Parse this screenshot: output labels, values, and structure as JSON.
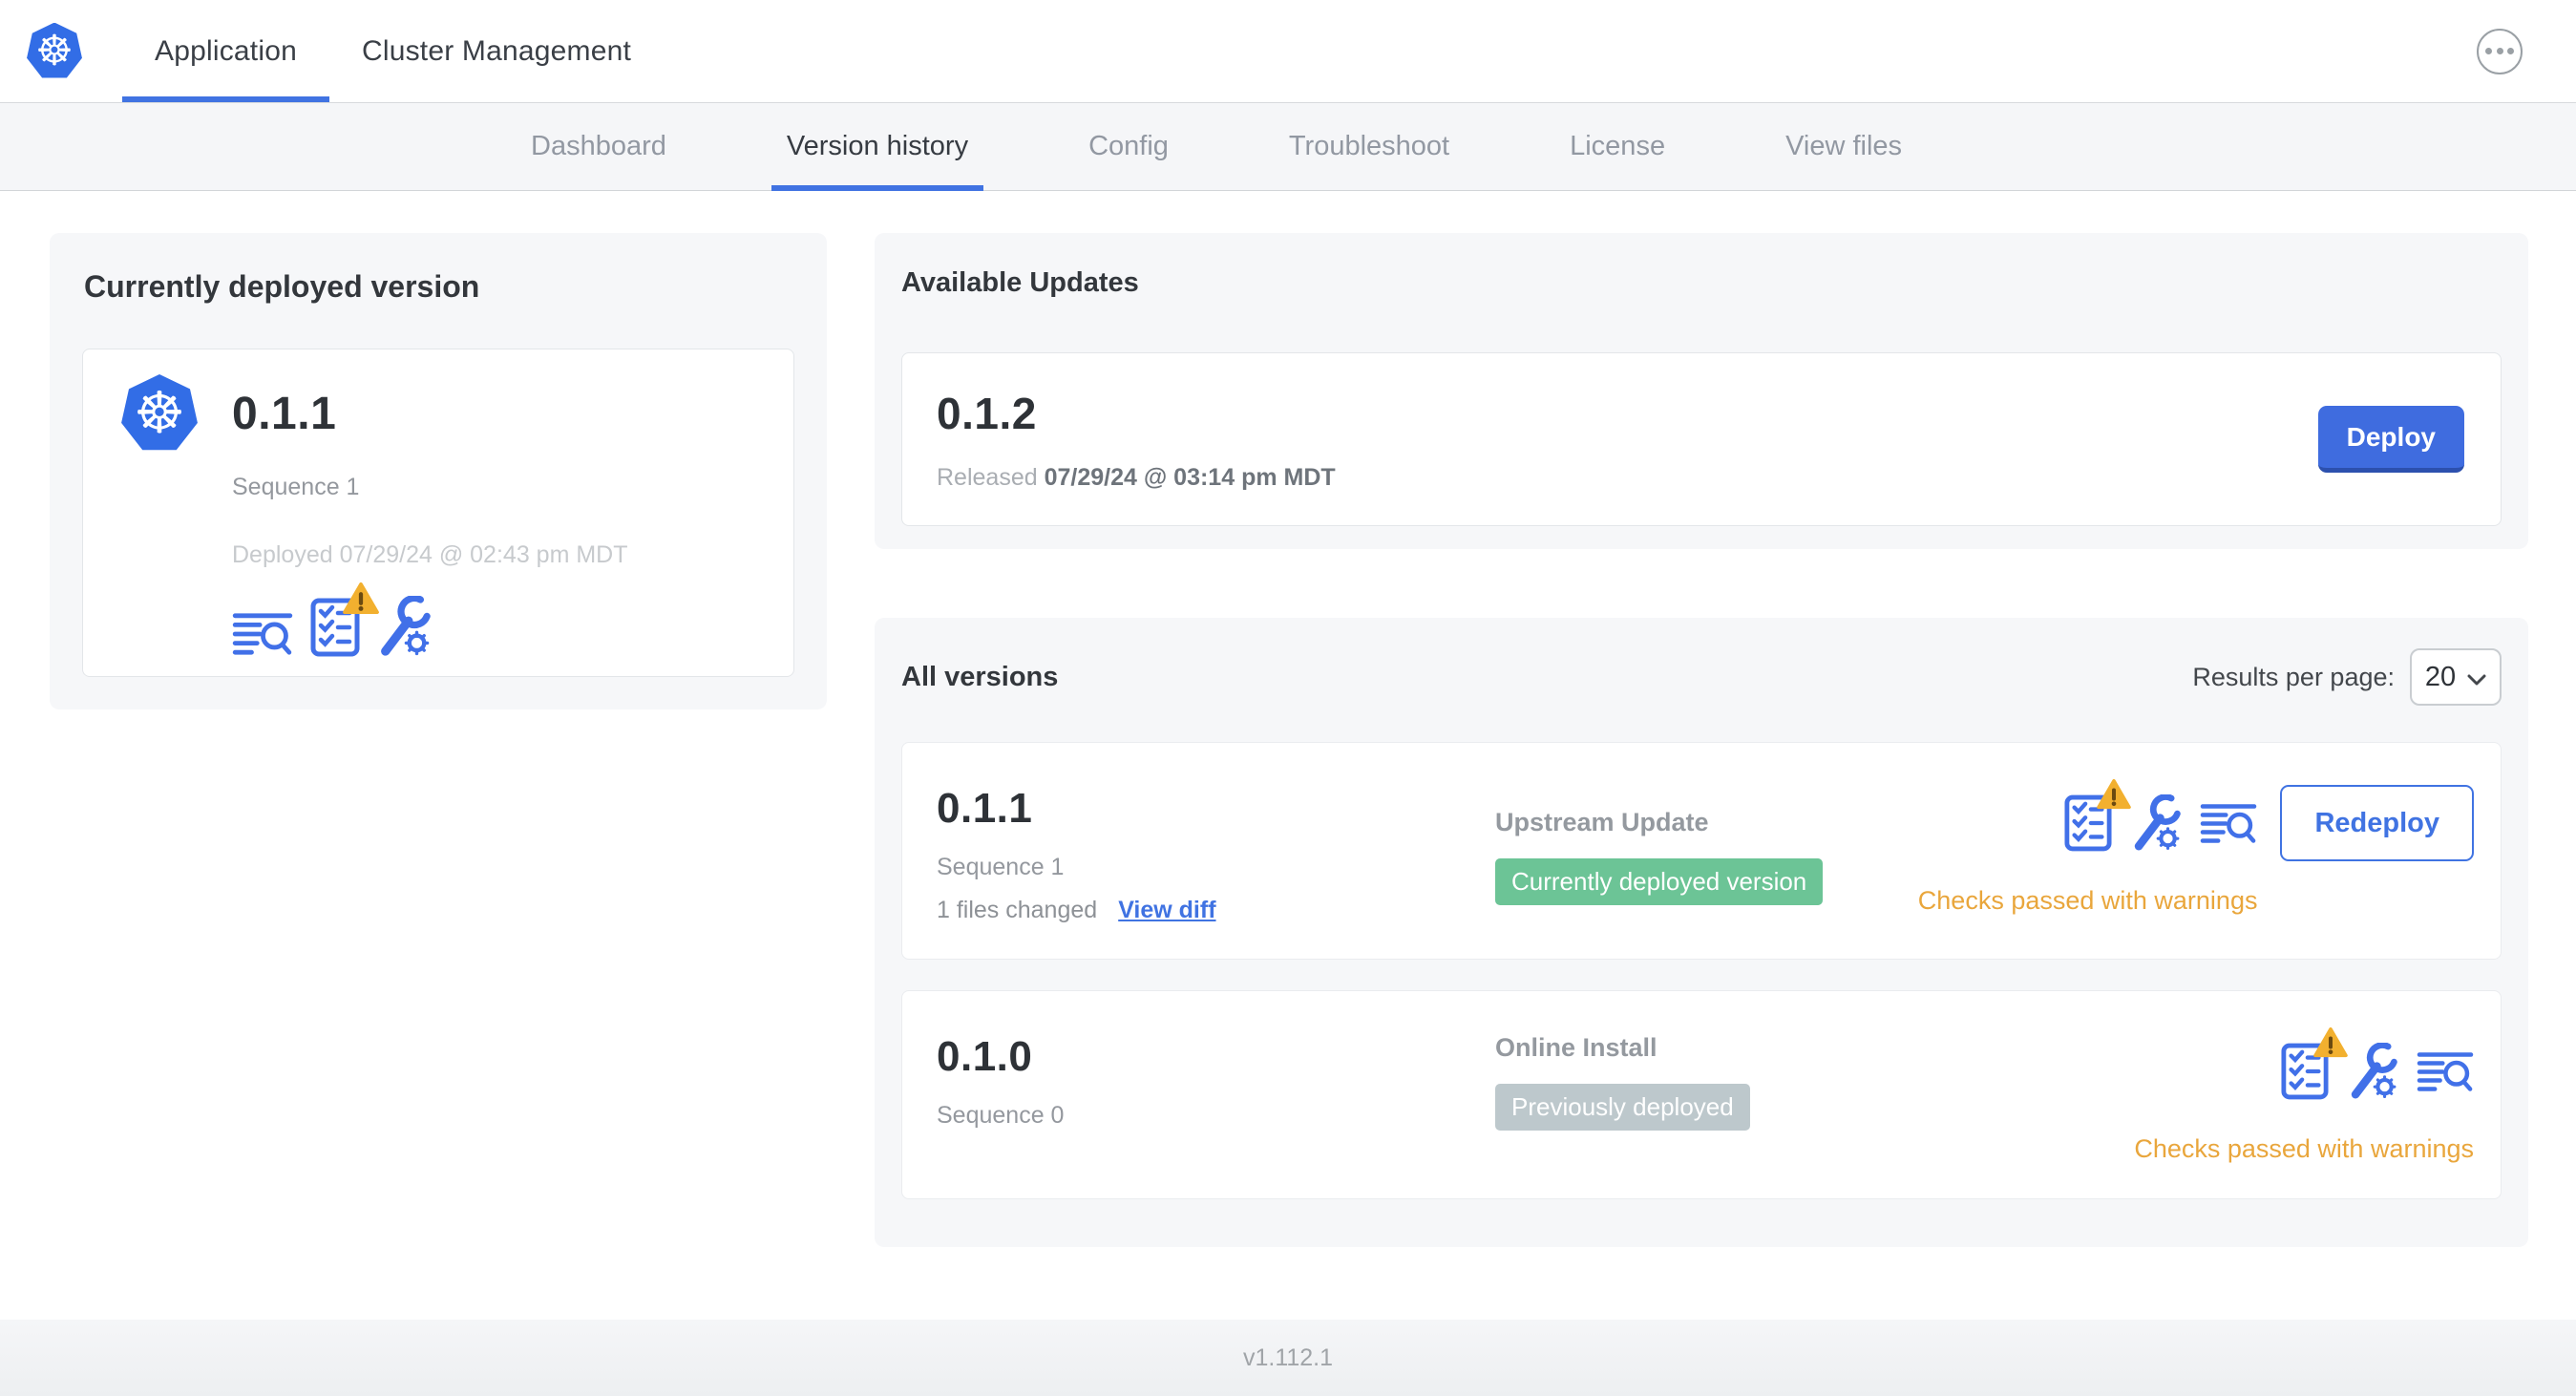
{
  "header": {
    "tabs": [
      {
        "label": "Application",
        "active": true
      },
      {
        "label": "Cluster Management",
        "active": false
      }
    ]
  },
  "subnav": {
    "tabs": [
      {
        "label": "Dashboard",
        "active": false
      },
      {
        "label": "Version history",
        "active": true
      },
      {
        "label": "Config",
        "active": false
      },
      {
        "label": "Troubleshoot",
        "active": false
      },
      {
        "label": "License",
        "active": false
      },
      {
        "label": "View files",
        "active": false
      }
    ]
  },
  "current_version": {
    "title": "Currently deployed version",
    "version": "0.1.1",
    "sequence": "Sequence 1",
    "deployed": "Deployed 07/29/24 @ 02:43 pm MDT"
  },
  "available_updates": {
    "title": "Available Updates",
    "version": "0.1.2",
    "released_label": "Released",
    "released_date": "07/29/24 @ 03:14 pm MDT",
    "deploy_label": "Deploy"
  },
  "all_versions": {
    "title": "All versions",
    "results_per_page_label": "Results per page:",
    "results_per_page_value": "20",
    "rows": [
      {
        "version": "0.1.1",
        "sequence": "Sequence 1",
        "files_changed": "1 files changed",
        "view_diff_label": "View diff",
        "source": "Upstream Update",
        "badge": "Currently deployed version",
        "badge_color": "green",
        "status": "Checks passed with warnings",
        "action_label": "Redeploy"
      },
      {
        "version": "0.1.0",
        "sequence": "Sequence 0",
        "source": "Online Install",
        "badge": "Previously deployed",
        "badge_color": "gray",
        "status": "Checks passed with warnings"
      }
    ]
  },
  "footer": {
    "app_version": "v1.112.1"
  },
  "icons": {
    "kubernetes_logo_glyph": "☸",
    "ellipsis": "ellipsis-icon",
    "deploy_logs": "deploy-logs-icon",
    "preflight_checks": "preflight-checks-icon",
    "warning": "warning-icon",
    "edit_config": "config-wrench-icon",
    "select_chevron": "chevron-down-icon"
  },
  "colors": {
    "accent_blue": "#4073e2",
    "kubernetes_blue": "#326de6",
    "deploy_button": "#3f6cdf",
    "badge_green": "#6cc496",
    "badge_gray": "#bdc8cc",
    "warning_amber": "#e9a63c",
    "card_gray": "#f6f7f9"
  }
}
